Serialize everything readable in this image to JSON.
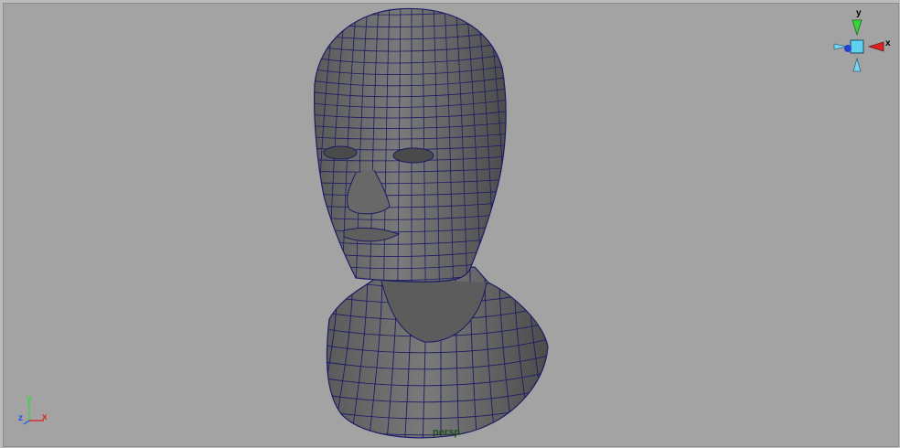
{
  "viewport": {
    "camera_label": "persp",
    "background_color": "#a3a3a3",
    "mesh_fill": "#6e6e6e",
    "wire_color": "#1b1b66"
  },
  "view_cube": {
    "y_label": "y",
    "x_label": "x"
  },
  "axis_triad": {
    "y_label": "y",
    "z_label": "z",
    "x_label": "x"
  }
}
